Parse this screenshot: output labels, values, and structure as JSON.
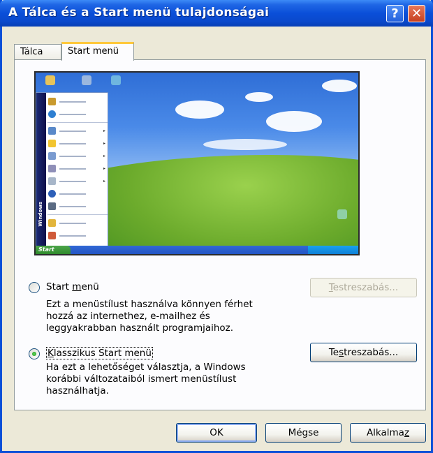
{
  "window": {
    "title": "A Tálca és a Start menü tulajdonságai",
    "help_glyph": "?",
    "close_glyph": "✕"
  },
  "tabs": [
    {
      "label": "Tálca",
      "selected": false
    },
    {
      "label": "Start menü",
      "selected": true
    }
  ],
  "preview": {
    "start_label": "Start",
    "band_label": "Windows"
  },
  "options": [
    {
      "label_pre": "Start ",
      "label_u": "m",
      "label_post": "enü",
      "selected": false,
      "description": [
        "Ezt a menüstílust használva könnyen férhet",
        "hozzá az internethez, e-mailhez és",
        "leggyakrabban használt programjaihoz."
      ],
      "customize": {
        "label_pre": "",
        "label_u": "T",
        "label_post": "estreszabás...",
        "enabled": false
      }
    },
    {
      "label_pre": "",
      "label_u": "K",
      "label_post": "lasszikus Start menü",
      "selected": true,
      "description": [
        "Ha ezt a lehetőséget választja, a Windows",
        "korábbi változataiból ismert menüstílust",
        "használhatja."
      ],
      "customize": {
        "label_pre": "Te",
        "label_u": "s",
        "label_post": "treszabás...",
        "enabled": true
      }
    }
  ],
  "buttons": {
    "ok": "OK",
    "cancel": "Mégse",
    "apply_pre": "Alkalma",
    "apply_u": "z"
  }
}
